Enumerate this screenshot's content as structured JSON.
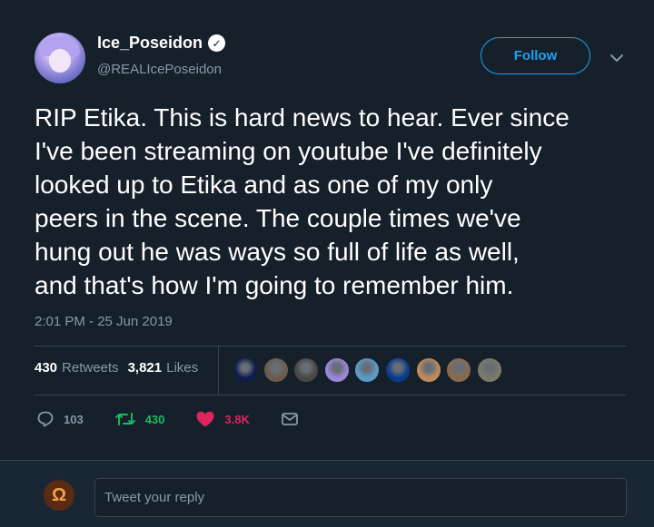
{
  "author": {
    "display_name": "Ice_Poseidon",
    "handle": "@REALIcePoseidon",
    "verified": true
  },
  "follow_button": {
    "label": "Follow"
  },
  "tweet": {
    "text": "RIP Etika. This is hard news to hear. Ever since\nI've been streaming on youtube I've definitely\nlooked up to Etika and as one of my only\npeers in the scene. The couple times we've\nhung out he was ways so full of life as well,\nand that's how I'm going to remember him.",
    "timestamp": "2:01 PM - 25 Jun 2019"
  },
  "stats": {
    "retweets_count": "430",
    "retweets_label": "Retweets",
    "likes_count": "3,821",
    "likes_label": "Likes"
  },
  "liker_avatars": [
    {
      "color": "#0f1d4d"
    },
    {
      "color": "#6b5b4a"
    },
    {
      "color": "#4a4642"
    },
    {
      "color": "#9b86d8"
    },
    {
      "color": "#5c9bc7"
    },
    {
      "color": "#0b3c8c"
    },
    {
      "color": "#c08a5e"
    },
    {
      "color": "#8a6a4f"
    },
    {
      "color": "#7a7a6b"
    }
  ],
  "actions": {
    "reply_count": "103",
    "retweet_count": "430",
    "like_count": "3.8K"
  },
  "reply_box": {
    "placeholder": "Tweet your reply",
    "avatar_glyph": "Ω"
  },
  "colors": {
    "background": "#15202b",
    "accent": "#1da1f2",
    "retweet_green": "#17bf63",
    "like_red": "#e0245e",
    "muted": "#8899a6"
  }
}
